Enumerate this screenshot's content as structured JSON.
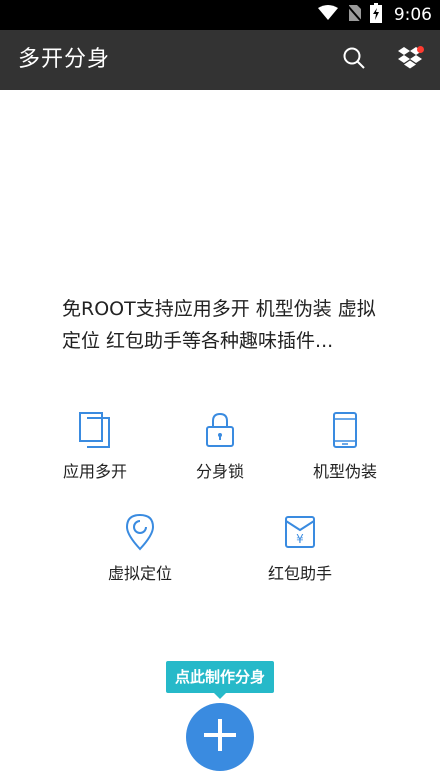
{
  "status_bar": {
    "time": "9:06"
  },
  "app_bar": {
    "title": "多开分身"
  },
  "main": {
    "description_line1": "免ROOT支持应用多开 机型伪装 虚拟",
    "description_line2": "定位 红包助手等各种趣味插件...",
    "features": [
      {
        "label": "应用多开",
        "icon": "copy-icon"
      },
      {
        "label": "分身锁",
        "icon": "lock-icon"
      },
      {
        "label": "机型伪装",
        "icon": "phone-icon"
      },
      {
        "label": "虚拟定位",
        "icon": "location-pin-icon"
      },
      {
        "label": "红包助手",
        "icon": "red-packet-icon"
      }
    ],
    "cta_label": "点此制作分身"
  },
  "colors": {
    "icon_blue": "#3a8be0",
    "cta_teal": "#26b9c9",
    "app_bar": "#333333"
  }
}
